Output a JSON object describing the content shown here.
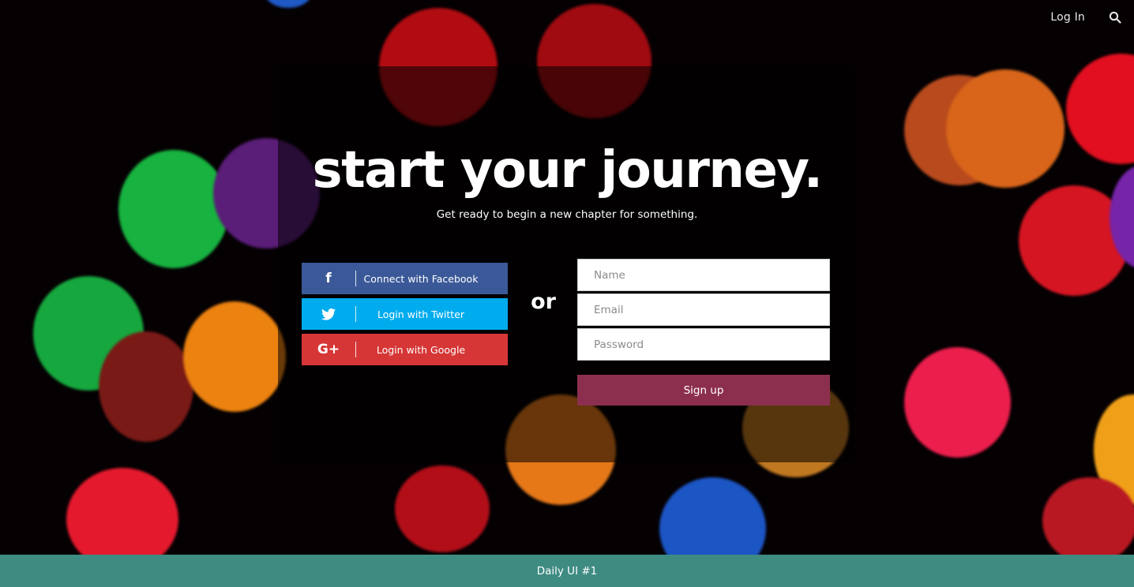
{
  "nav": {
    "login_label": "Log In",
    "search_icon": "search-icon"
  },
  "hero": {
    "title": "start your journey.",
    "subtitle": "Get ready to begin a new chapter for something."
  },
  "social": {
    "facebook": {
      "icon": "f",
      "label": "Connect with Facebook",
      "color": "#3b5998"
    },
    "twitter": {
      "icon": "twitter-bird",
      "label": "Login with Twitter",
      "color": "#00acee"
    },
    "google": {
      "icon": "G+",
      "label": "Login with Google",
      "color": "#d63636"
    }
  },
  "divider_text": "or",
  "form": {
    "name_placeholder": "Name",
    "email_placeholder": "Email",
    "password_placeholder": "Password",
    "submit_label": "Sign up",
    "submit_color": "#8c2f4e"
  },
  "footer": {
    "label": "Daily UI #1",
    "color": "#3e8b82"
  }
}
